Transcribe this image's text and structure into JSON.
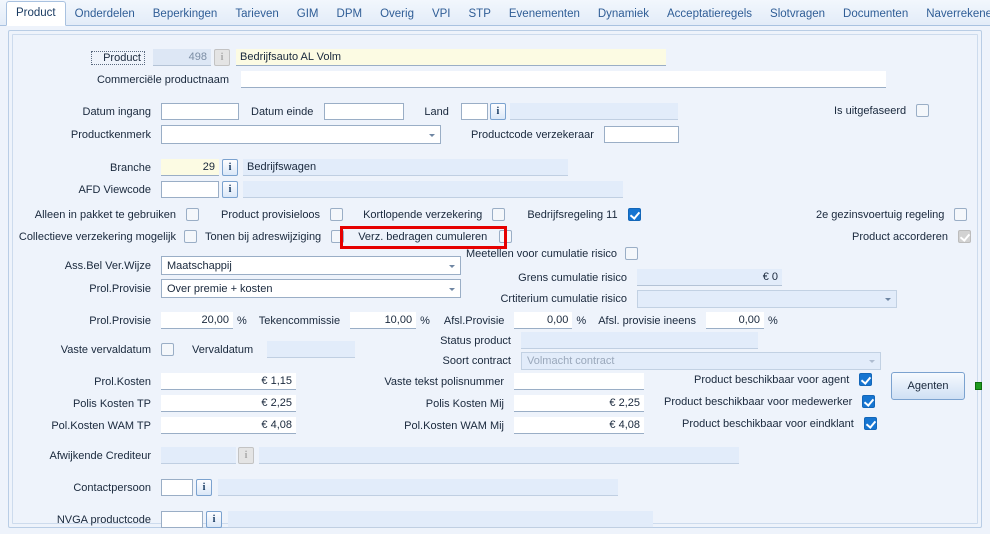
{
  "tabs": [
    {
      "label": "Product",
      "active": true
    },
    {
      "label": "Onderdelen",
      "active": false
    },
    {
      "label": "Beperkingen",
      "active": false
    },
    {
      "label": "Tarieven",
      "active": false
    },
    {
      "label": "GIM",
      "active": false
    },
    {
      "label": "DPM",
      "active": false
    },
    {
      "label": "Overig",
      "active": false
    },
    {
      "label": "VPI",
      "active": false
    },
    {
      "label": "STP",
      "active": false
    },
    {
      "label": "Evenementen",
      "active": false
    },
    {
      "label": "Dynamiek",
      "active": false
    },
    {
      "label": "Acceptatieregels",
      "active": false
    },
    {
      "label": "Slotvragen",
      "active": false
    },
    {
      "label": "Documenten",
      "active": false
    },
    {
      "label": "Naverrekenen",
      "active": false
    }
  ],
  "form": {
    "product_label": "Product",
    "product_code": "498",
    "product_name": "Bedrijfsauto AL Volm",
    "commerciele_productnaam_label": "Commerciële productnaam",
    "commerciele_productnaam": "",
    "datum_ingang_label": "Datum ingang",
    "datum_ingang": "",
    "datum_einde_label": "Datum einde",
    "datum_einde": "",
    "land_label": "Land",
    "land_code": "",
    "land_name": "",
    "is_uitgefaseerd_label": "Is uitgefaseerd",
    "productkenmerk_label": "Productkenmerk",
    "productkenmerk": "",
    "productcode_verzekeraar_label": "Productcode verzekeraar",
    "productcode_verzekeraar": "",
    "branche_label": "Branche",
    "branche_code": "29",
    "branche_name": "Bedrijfswagen",
    "afd_viewcode_label": "AFD Viewcode",
    "afd_viewcode": "",
    "afd_viewcode_name": "",
    "chk_alleen_in_pakket": "Alleen in pakket te gebruiken",
    "chk_product_provisieloos": "Product provisieloos",
    "chk_kortlopende_verzekering": "Kortlopende verzekering",
    "chk_bedrijfsregeling_11": "Bedrijfsregeling 11",
    "chk_2e_gezinsvoertuig": "2e gezinsvoertuig regeling",
    "chk_collectieve_verzekering": "Collectieve verzekering mogelijk",
    "chk_tonen_bij_adreswijziging": "Tonen bij adreswijziging",
    "chk_verz_bedragen_cumuleren": "Verz. bedragen cumuleren",
    "chk_product_accorderen": "Product accorderen",
    "ass_bel_ver_wijze_label": "Ass.Bel Ver.Wijze",
    "ass_bel_ver_wijze": "Maatschappij",
    "prol_provisie_label": "Prol.Provisie",
    "prol_provisie_soort": "Over premie + kosten",
    "meetellen_cumulatie_label": "Meetellen voor cumulatie risico",
    "grens_cumulatie_label": "Grens cumulatie risico",
    "grens_cumulatie_value": "€ 0",
    "criterium_cumulatie_label": "Crtiterium cumulatie risico",
    "criterium_cumulatie_value": "",
    "prol_provisie_pct_label": "Prol.Provisie",
    "prol_provisie_pct": "20,00",
    "tekencommissie_label": "Tekencommissie",
    "tekencommissie": "10,00",
    "afsl_provisie_label": "Afsl.Provisie",
    "afsl_provisie": "0,00",
    "afsl_provisie_ineens_label": "Afsl. provisie ineens",
    "afsl_provisie_ineens": "0,00",
    "pct_sign": "%",
    "vaste_vervaldatum_label": "Vaste vervaldatum",
    "vervaldatum_label": "Vervaldatum",
    "vervaldatum": "",
    "status_product_label": "Status product",
    "status_product": "",
    "soort_contract_label": "Soort contract",
    "soort_contract": "Volmacht contract",
    "prol_kosten_label": "Prol.Kosten",
    "prol_kosten": "€ 1,15",
    "polis_kosten_tp_label": "Polis Kosten TP",
    "polis_kosten_tp": "€ 2,25",
    "pol_kosten_wam_tp_label": "Pol.Kosten WAM TP",
    "pol_kosten_wam_tp": "€ 4,08",
    "vaste_tekst_polisnummer_label": "Vaste tekst polisnummer",
    "vaste_tekst_polisnummer": "",
    "polis_kosten_mij_label": "Polis Kosten Mij",
    "polis_kosten_mij": "€ 2,25",
    "pol_kosten_wam_mij_label": "Pol.Kosten WAM Mij",
    "pol_kosten_wam_mij": "€ 4,08",
    "chk_beschikbaar_agent": "Product beschikbaar voor agent",
    "chk_beschikbaar_medewerker": "Product beschikbaar voor medewerker",
    "chk_beschikbaar_eindklant": "Product beschikbaar voor eindklant",
    "agenten_button": "Agenten",
    "afwijkende_crediteur_label": "Afwijkende Crediteur",
    "afwijkende_crediteur_code": "",
    "afwijkende_crediteur_name": "",
    "contactpersoon_label": "Contactpersoon",
    "contactpersoon_code": "",
    "contactpersoon_name": "",
    "nvga_productcode_label": "NVGA productcode",
    "nvga_productcode": "",
    "nvga_productcode_name": ""
  },
  "icons": {
    "info": "i"
  },
  "colors": {
    "accent": "#1675d1",
    "highlight": "#e60000",
    "tab_text": "#2f5d96",
    "status_green": "#1f9b1f"
  }
}
